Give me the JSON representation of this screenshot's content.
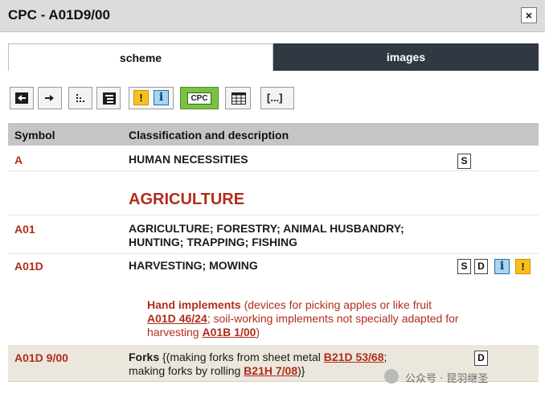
{
  "window": {
    "title": "CPC - A01D9/00",
    "close_label": "×"
  },
  "tabs": [
    {
      "label": "scheme"
    },
    {
      "label": "images"
    }
  ],
  "toolbar": {
    "cpc_label": "CPC",
    "brackets_label": "[...]",
    "info_label": "i",
    "warning_label": "!"
  },
  "table": {
    "col_symbol": "Symbol",
    "col_desc": "Classification and description"
  },
  "rows": [
    {
      "symbol": "A",
      "description": "HUMAN NECESSITIES"
    },
    {
      "section_heading": "AGRICULTURE"
    },
    {
      "symbol": "A01",
      "description_line1": "AGRICULTURE; FORESTRY; ANIMAL HUSBANDRY;",
      "description_line2": "HUNTING; TRAPPING; FISHING"
    },
    {
      "symbol": "A01D",
      "description": "HARVESTING; MOWING"
    }
  ],
  "badges": {
    "s": "S",
    "d": "D",
    "i": "i",
    "warn": "!"
  },
  "note": {
    "title": "Hand implements",
    "text1": " (devices for picking apples or like fruit ",
    "ref1": "A01D 46/24",
    "text2": "; soil-working implements not specially adapted for harvesting ",
    "ref2": "A01B 1/00",
    "text3": ")"
  },
  "current": {
    "symbol": "A01D 9/00",
    "title": "Forks",
    "text1": " {(making forks from sheet metal ",
    "ref1": "B21D 53/68",
    "text2": ";",
    "text3": "making forks by rolling ",
    "ref2": "B21H 7/08",
    "text4": ")}"
  },
  "watermark": {
    "text": "公众号 · 昆羽继圣"
  }
}
